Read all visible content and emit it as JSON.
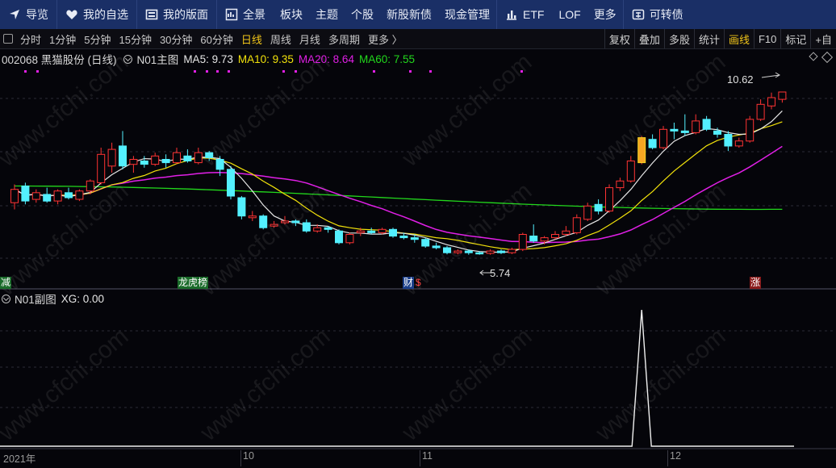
{
  "nav": {
    "guide": "导览",
    "watchlist": "我的自选",
    "layout": "我的版面",
    "overview": "全景",
    "sector": "板块",
    "theme": "主题",
    "stock": "个股",
    "ipo": "新股新债",
    "cash": "现金管理",
    "etf": "ETF",
    "lof": "LOF",
    "more": "更多",
    "convertible": "可转债"
  },
  "periods": [
    "分时",
    "1分钟",
    "5分钟",
    "15分钟",
    "30分钟",
    "60分钟",
    "日线",
    "周线",
    "月线",
    "多周期",
    "更多 〉"
  ],
  "active_period": "日线",
  "tools": [
    "复权",
    "叠加",
    "多股",
    "统计",
    "画线",
    "F10",
    "标记",
    "+自"
  ],
  "highlight_tool": "画线",
  "main_header": {
    "code_name": "002068 黑猫股份 (日线)",
    "indicator": "N01主图",
    "ma5": "MA5: 9.73",
    "ma10": "MA10: 9.35",
    "ma20": "MA20: 8.64",
    "ma60": "MA60: 7.55"
  },
  "sub_header": {
    "indicator": "N01副图",
    "xg": "XG: 0.00"
  },
  "annotations": {
    "high": "10.62",
    "low": "5.74"
  },
  "event_tags": {
    "reduce": "减",
    "limit_list": "龙虎榜",
    "finance": "财",
    "finance_s": "$",
    "rise": "涨"
  },
  "x_labels": {
    "y2021": "2021年",
    "m10": "10",
    "m11": "11",
    "m12": "12"
  },
  "watermark": "www.cfchi.com",
  "colors": {
    "up": "#ff3333",
    "down": "#53f0ff",
    "ma5": "#e6e6e6",
    "ma10": "#f2e20a",
    "ma20": "#e01fe6",
    "ma60": "#22d81c",
    "nav_bg": "#1a2f66",
    "active": "#f0c419"
  },
  "chart_data": {
    "type": "candlestick",
    "title": "002068 黑猫股份 (日线)",
    "price_range": [
      5.2,
      11.2
    ],
    "candles": [
      {
        "o": 7.3,
        "c": 7.7,
        "h": 7.85,
        "l": 7.1
      },
      {
        "o": 7.8,
        "c": 7.35,
        "h": 7.9,
        "l": 7.25
      },
      {
        "o": 7.4,
        "c": 7.6,
        "h": 7.7,
        "l": 7.3
      },
      {
        "o": 7.55,
        "c": 7.35,
        "h": 7.75,
        "l": 7.3
      },
      {
        "o": 7.35,
        "c": 7.65,
        "h": 7.7,
        "l": 7.25
      },
      {
        "o": 7.6,
        "c": 7.45,
        "h": 7.75,
        "l": 7.4
      },
      {
        "o": 7.4,
        "c": 7.65,
        "h": 7.7,
        "l": 7.35
      },
      {
        "o": 7.65,
        "c": 7.95,
        "h": 8.0,
        "l": 7.55
      },
      {
        "o": 7.9,
        "c": 8.75,
        "h": 8.95,
        "l": 7.85
      },
      {
        "o": 8.4,
        "c": 8.9,
        "h": 9.1,
        "l": 8.2
      },
      {
        "o": 9.0,
        "c": 8.4,
        "h": 9.45,
        "l": 8.3
      },
      {
        "o": 8.45,
        "c": 8.6,
        "h": 8.7,
        "l": 8.2
      },
      {
        "o": 8.55,
        "c": 8.45,
        "h": 8.7,
        "l": 8.35
      },
      {
        "o": 8.45,
        "c": 8.7,
        "h": 8.8,
        "l": 8.4
      },
      {
        "o": 8.6,
        "c": 8.5,
        "h": 8.75,
        "l": 8.35
      },
      {
        "o": 8.5,
        "c": 8.8,
        "h": 8.95,
        "l": 8.45
      },
      {
        "o": 8.7,
        "c": 8.55,
        "h": 8.9,
        "l": 8.5
      },
      {
        "o": 8.5,
        "c": 8.8,
        "h": 8.95,
        "l": 8.45
      },
      {
        "o": 8.8,
        "c": 8.65,
        "h": 8.85,
        "l": 8.55
      },
      {
        "o": 8.6,
        "c": 8.3,
        "h": 8.7,
        "l": 8.1
      },
      {
        "o": 8.3,
        "c": 7.5,
        "h": 8.4,
        "l": 7.4
      },
      {
        "o": 7.45,
        "c": 6.9,
        "h": 7.5,
        "l": 6.8
      },
      {
        "o": 6.85,
        "c": 6.9,
        "h": 7.05,
        "l": 6.75
      },
      {
        "o": 6.9,
        "c": 6.55,
        "h": 6.95,
        "l": 6.5
      },
      {
        "o": 6.6,
        "c": 6.65,
        "h": 6.75,
        "l": 6.55
      },
      {
        "o": 6.7,
        "c": 6.75,
        "h": 6.9,
        "l": 6.65
      },
      {
        "o": 6.75,
        "c": 6.7,
        "h": 6.8,
        "l": 6.6
      },
      {
        "o": 6.7,
        "c": 6.45,
        "h": 6.8,
        "l": 6.4
      },
      {
        "o": 6.45,
        "c": 6.55,
        "h": 6.65,
        "l": 6.4
      },
      {
        "o": 6.55,
        "c": 6.5,
        "h": 6.6,
        "l": 6.4
      },
      {
        "o": 6.45,
        "c": 6.1,
        "h": 6.5,
        "l": 6.05
      },
      {
        "o": 6.1,
        "c": 6.35,
        "h": 6.4,
        "l": 6.05
      },
      {
        "o": 6.4,
        "c": 6.45,
        "h": 6.55,
        "l": 6.3
      },
      {
        "o": 6.45,
        "c": 6.4,
        "h": 6.55,
        "l": 6.35
      },
      {
        "o": 6.4,
        "c": 6.5,
        "h": 6.55,
        "l": 6.35
      },
      {
        "o": 6.5,
        "c": 6.3,
        "h": 6.55,
        "l": 6.25
      },
      {
        "o": 6.3,
        "c": 6.25,
        "h": 6.4,
        "l": 6.2
      },
      {
        "o": 6.25,
        "c": 6.2,
        "h": 6.35,
        "l": 6.1
      },
      {
        "o": 6.2,
        "c": 6.0,
        "h": 6.25,
        "l": 5.95
      },
      {
        "o": 6.0,
        "c": 5.95,
        "h": 6.1,
        "l": 5.9
      },
      {
        "o": 5.95,
        "c": 5.8,
        "h": 6.0,
        "l": 5.75
      },
      {
        "o": 5.8,
        "c": 5.85,
        "h": 5.9,
        "l": 5.75
      },
      {
        "o": 5.85,
        "c": 5.8,
        "h": 5.9,
        "l": 5.74
      },
      {
        "o": 5.8,
        "c": 5.78,
        "h": 5.85,
        "l": 5.74
      },
      {
        "o": 5.78,
        "c": 5.85,
        "h": 5.9,
        "l": 5.74
      },
      {
        "o": 5.85,
        "c": 5.8,
        "h": 5.9,
        "l": 5.76
      },
      {
        "o": 5.8,
        "c": 5.9,
        "h": 5.95,
        "l": 5.76
      },
      {
        "o": 5.9,
        "c": 6.35,
        "h": 6.4,
        "l": 5.85
      },
      {
        "o": 6.3,
        "c": 6.15,
        "h": 6.65,
        "l": 6.1
      },
      {
        "o": 6.15,
        "c": 6.25,
        "h": 6.3,
        "l": 6.05
      },
      {
        "o": 6.25,
        "c": 6.35,
        "h": 6.45,
        "l": 6.2
      },
      {
        "o": 6.35,
        "c": 6.45,
        "h": 6.6,
        "l": 6.3
      },
      {
        "o": 6.4,
        "c": 6.85,
        "h": 6.95,
        "l": 6.35
      },
      {
        "o": 6.8,
        "c": 7.2,
        "h": 7.3,
        "l": 6.75
      },
      {
        "o": 7.25,
        "c": 7.05,
        "h": 7.4,
        "l": 6.95
      },
      {
        "o": 7.05,
        "c": 7.75,
        "h": 7.85,
        "l": 7.0
      },
      {
        "o": 7.75,
        "c": 7.95,
        "h": 8.05,
        "l": 7.65
      },
      {
        "o": 7.95,
        "c": 8.55,
        "h": 8.7,
        "l": 7.9
      },
      {
        "o": 8.5,
        "c": 9.25,
        "h": 9.3,
        "l": 8.45
      },
      {
        "o": 9.2,
        "c": 8.95,
        "h": 9.35,
        "l": 8.9
      },
      {
        "o": 8.95,
        "c": 9.5,
        "h": 9.6,
        "l": 8.9
      },
      {
        "o": 9.5,
        "c": 9.45,
        "h": 9.7,
        "l": 9.2
      },
      {
        "o": 9.45,
        "c": 9.4,
        "h": 9.95,
        "l": 9.3
      },
      {
        "o": 9.4,
        "c": 9.75,
        "h": 9.95,
        "l": 9.35
      },
      {
        "o": 9.8,
        "c": 9.5,
        "h": 9.9,
        "l": 9.45
      },
      {
        "o": 9.45,
        "c": 9.35,
        "h": 9.55,
        "l": 9.25
      },
      {
        "o": 9.35,
        "c": 9.0,
        "h": 9.45,
        "l": 8.85
      },
      {
        "o": 9.0,
        "c": 9.15,
        "h": 9.25,
        "l": 8.95
      },
      {
        "o": 9.15,
        "c": 9.8,
        "h": 9.9,
        "l": 9.1
      },
      {
        "o": 9.8,
        "c": 10.25,
        "h": 10.4,
        "l": 9.75
      },
      {
        "o": 10.2,
        "c": 10.45,
        "h": 10.6,
        "l": 10.1
      },
      {
        "o": 10.4,
        "c": 10.62,
        "h": 10.62,
        "l": 10.3
      }
    ],
    "sub_signal": {
      "name": "XG",
      "range": [
        0,
        1
      ],
      "spike_index": 58,
      "value": 0.0
    }
  }
}
